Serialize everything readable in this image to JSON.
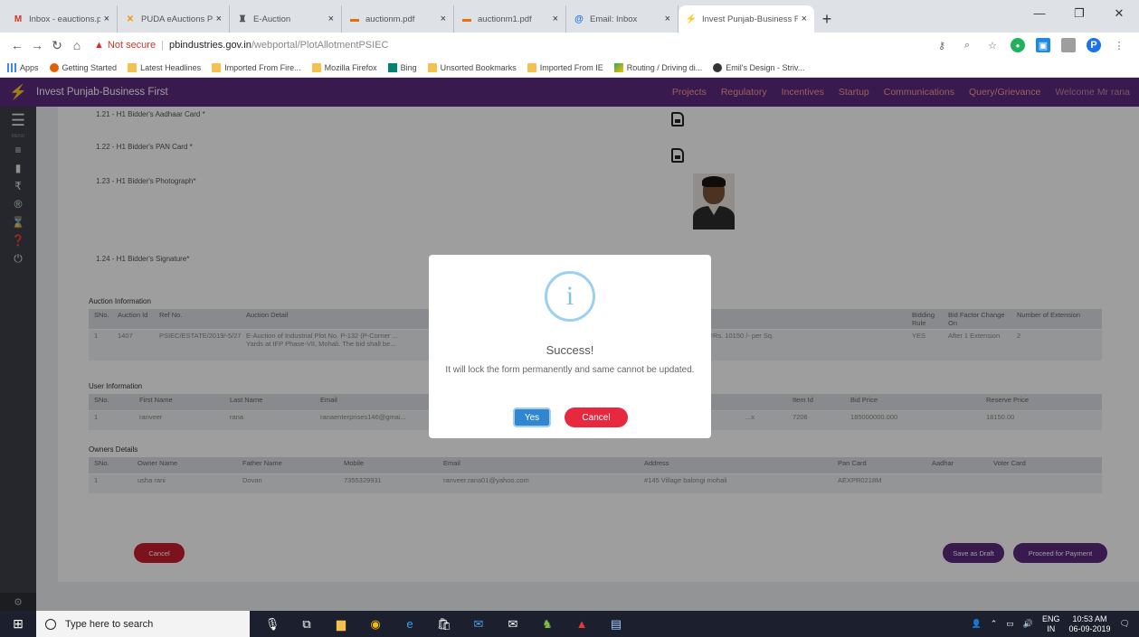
{
  "browser": {
    "tabs": [
      {
        "title": "Inbox - eauctions.psiec@",
        "favicon": "gmail-icon",
        "color": "#d93025"
      },
      {
        "title": "PUDA eAuctions Portal |",
        "favicon": "puda-icon",
        "color": "#f29900"
      },
      {
        "title": "E-Auction",
        "favicon": "auction-icon",
        "color": "#555555"
      },
      {
        "title": "auctionm.pdf",
        "favicon": "pdf-icon",
        "color": "#e8710a"
      },
      {
        "title": "auctionm1.pdf",
        "favicon": "pdf-icon",
        "color": "#e8710a"
      },
      {
        "title": "Email: Inbox",
        "favicon": "email-icon",
        "color": "#1a73e8"
      },
      {
        "title": "Invest Punjab-Business F",
        "favicon": "investpunjab-icon",
        "color": "#ff5722",
        "active": true
      }
    ],
    "address": {
      "not_secure": "Not secure",
      "domain": "pbindustries.gov.in",
      "path": "/webportal/PlotAllotmentPSIEC"
    },
    "bookmarks": [
      {
        "label": "Apps",
        "icon": "apps-icon"
      },
      {
        "label": "Getting Started",
        "icon": "firefox-icon"
      },
      {
        "label": "Latest Headlines",
        "icon": "folder-icon"
      },
      {
        "label": "Imported From Fire...",
        "icon": "folder-icon"
      },
      {
        "label": "Mozilla Firefox",
        "icon": "folder-icon"
      },
      {
        "label": "Bing",
        "icon": "bing-icon"
      },
      {
        "label": "Unsorted Bookmarks",
        "icon": "folder-icon"
      },
      {
        "label": "Imported From IE",
        "icon": "folder-icon"
      },
      {
        "label": "Routing / Driving di...",
        "icon": "routing-icon"
      },
      {
        "label": "Emil's Design - Striv...",
        "icon": "github-icon"
      }
    ]
  },
  "app": {
    "title": "Invest Punjab-Business First",
    "nav": [
      "Projects",
      "Regulatory",
      "Incentives",
      "Startup",
      "Communications",
      "Query/Grievance"
    ],
    "welcome": "Welcome Mr rana",
    "menu_label": "MENU"
  },
  "documents": [
    {
      "label": "1.21 - H1 Bidder's Aadhaar Card *"
    },
    {
      "label": "1.22 - H1 Bidder's PAN Card *"
    },
    {
      "label": "1.23 - H1 Bidder's Photograph*"
    },
    {
      "label": "1.24 - H1 Bidder's Signature*"
    }
  ],
  "auction": {
    "section_title": "Auction Information",
    "headers": [
      "SNo.",
      "Auction Id",
      "Ref No.",
      "Auction Detail",
      "",
      "Bidding Rule",
      "Bid Factor Change On",
      "Number of Extension"
    ],
    "row": [
      "1",
      "1407",
      "PSIEC/ESTATE/2019/-5/27",
      "E-Auction of Industrial Plot No. P-132 (P-Corner ...",
      "...ng to Rs. 90,75,000/- @Rs. 10150 /- per Sq.",
      "YES",
      "After 1 Extension",
      "2"
    ],
    "row_detail_line2": "Yards at IFP Phase-VII, Mohali. The bid shall be..."
  },
  "user": {
    "section_title": "User Information",
    "headers": [
      "SNo.",
      "First Name",
      "Last Name",
      "Email",
      "",
      "Item Id",
      "Bid Price",
      "Reserve Price"
    ],
    "row": [
      "1",
      "ranveer",
      "rana",
      "ranaenterprises146@gmai...",
      "...x",
      "7206",
      "185000000.000",
      "18150.00"
    ]
  },
  "owners": {
    "section_title": "Owners Details",
    "headers": [
      "SNo.",
      "Owner Name",
      "Father Name",
      "Mobile",
      "Email",
      "Address",
      "Pan Card",
      "Aadhar",
      "Voter Card"
    ],
    "row": [
      "1",
      "usha rani",
      "Dovan",
      "7355329931",
      "ranveer.rana01@yahoo.com",
      "#145 Village balongi mohali",
      "AEXPR0218M",
      "",
      ""
    ]
  },
  "actions": {
    "cancel": "Cancel",
    "save_draft": "Save as Draft",
    "proceed": "Proceed for Payment"
  },
  "modal": {
    "icon": "i",
    "title": "Success!",
    "text": "It will lock the form permanently and same cannot be updated.",
    "yes": "Yes",
    "cancel": "Cancel"
  },
  "taskbar": {
    "search_placeholder": "Type here to search",
    "lang_top": "ENG",
    "lang_bottom": "IN",
    "time": "10:53 AM",
    "date": "06-09-2019"
  },
  "colors": {
    "header": "#5c2a7e",
    "accent_red": "#c8202e",
    "yes_blue": "#2f86d1"
  }
}
